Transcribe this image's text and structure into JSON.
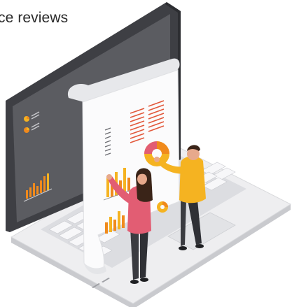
{
  "caption": {
    "text": "ce reviews"
  },
  "illustration": {
    "subject": "laptop-with-report-and-two-people",
    "colors": {
      "laptop_shell": "#eeeef0",
      "laptop_edge": "#d3d4d8",
      "bezel": "#3e3f44",
      "screen": "#5b5c61",
      "keyboard": "#f3f3f5",
      "paper": "#fbfbfc",
      "accent_orange": "#f08a1c",
      "accent_yellow": "#f5b321",
      "woman_top": "#e25d73",
      "man_shirt": "#f5b321",
      "trousers": "#3a3b40",
      "skin": "#e7a98c",
      "hair": "#3a2418"
    }
  }
}
